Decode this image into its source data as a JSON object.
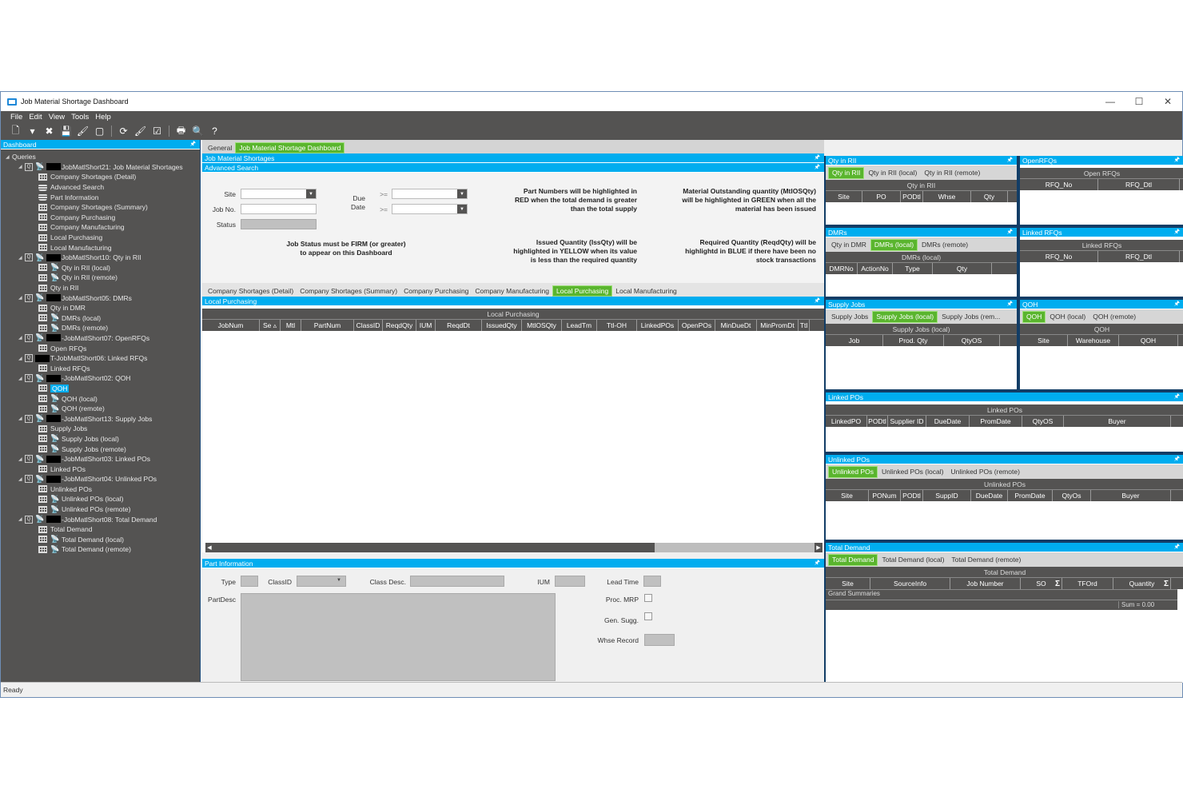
{
  "window": {
    "title": "Job Material Shortage Dashboard",
    "controls": {
      "minimize": "—",
      "maximize": "☐",
      "close": "✕"
    }
  },
  "menu": [
    "File",
    "Edit",
    "View",
    "Tools",
    "Help"
  ],
  "toolbar": [
    {
      "icon": "new-icon",
      "glyph": "🗋"
    },
    {
      "icon": "dropdown-icon",
      "glyph": "▾"
    },
    {
      "icon": "delete-icon",
      "glyph": "✖"
    },
    {
      "icon": "save-icon",
      "glyph": "💾"
    },
    {
      "icon": "clear-icon",
      "glyph": "🖌"
    },
    {
      "icon": "note-icon",
      "glyph": "▢"
    },
    {
      "icon": "refresh-icon",
      "glyph": "⟳"
    },
    {
      "icon": "clear-all-icon",
      "glyph": "🖌"
    },
    {
      "icon": "check-icon",
      "glyph": "☑"
    },
    {
      "icon": "print-icon",
      "glyph": "🖶"
    },
    {
      "icon": "preview-icon",
      "glyph": "🔍"
    },
    {
      "icon": "help-icon",
      "glyph": "?"
    }
  ],
  "sidebar": {
    "title": "Dashboard",
    "pin": "🖈",
    "root": "Queries",
    "items": [
      {
        "type": "query",
        "label": "JobMatlShort21: Job Material Shortages"
      },
      {
        "type": "grid",
        "label": "Company Shortages (Detail)"
      },
      {
        "type": "form",
        "label": "Advanced Search"
      },
      {
        "type": "form",
        "label": "Part Information"
      },
      {
        "type": "grid",
        "label": "Company Shortages (Summary)"
      },
      {
        "type": "grid",
        "label": "Company Purchasing"
      },
      {
        "type": "grid",
        "label": "Company Manufacturing"
      },
      {
        "type": "grid",
        "label": "Local Purchasing"
      },
      {
        "type": "grid",
        "label": "Local Manufacturing"
      },
      {
        "type": "query",
        "label": "JobMatlShort10: Qty in RII"
      },
      {
        "type": "remote",
        "label": "Qty in RII (local)"
      },
      {
        "type": "remote",
        "label": "Qty in RII (remote)"
      },
      {
        "type": "grid",
        "label": "Qty in RII"
      },
      {
        "type": "query",
        "label": "JobMatlShort05: DMRs"
      },
      {
        "type": "grid",
        "label": "Qty in DMR"
      },
      {
        "type": "remote",
        "label": "DMRs (local)"
      },
      {
        "type": "remote",
        "label": "DMRs (remote)"
      },
      {
        "type": "query",
        "label": "-JobMatlShort07: OpenRFQs"
      },
      {
        "type": "grid",
        "label": "Open RFQs"
      },
      {
        "type": "query2",
        "label": "T-JobMatlShort06: Linked RFQs"
      },
      {
        "type": "grid",
        "label": "Linked RFQs"
      },
      {
        "type": "query",
        "label": "-JobMatlShort02: QOH"
      },
      {
        "type": "grid",
        "label": "QOH",
        "selected": true
      },
      {
        "type": "remote",
        "label": "QOH (local)"
      },
      {
        "type": "remote",
        "label": "QOH (remote)"
      },
      {
        "type": "query",
        "label": "-JobMatlShort13: Supply Jobs"
      },
      {
        "type": "grid",
        "label": "Supply Jobs"
      },
      {
        "type": "remote",
        "label": "Supply Jobs (local)"
      },
      {
        "type": "remote",
        "label": "Supply Jobs (remote)"
      },
      {
        "type": "query",
        "label": "-JobMatlShort03: Linked POs"
      },
      {
        "type": "grid",
        "label": "Linked POs"
      },
      {
        "type": "query",
        "label": "-JobMatlShort04: Unlinked POs"
      },
      {
        "type": "grid",
        "label": "Unlinked POs"
      },
      {
        "type": "remote",
        "label": "Unlinked POs (local)"
      },
      {
        "type": "remote",
        "label": "Unlinked POs (remote)"
      },
      {
        "type": "query",
        "label": "-JobMatlShort08: Total Demand"
      },
      {
        "type": "grid",
        "label": "Total Demand"
      },
      {
        "type": "remote",
        "label": "Total Demand (local)"
      },
      {
        "type": "remote",
        "label": "Total Demand (remote)"
      }
    ]
  },
  "main": {
    "tabs": [
      "General",
      "Job Material Shortage Dashboard"
    ],
    "active_tab": 1,
    "section_title": "Job Material Shortages",
    "advanced": {
      "title": "Advanced Search",
      "site_label": "Site",
      "site_value": "",
      "jobno_label": "Job No.",
      "jobno_value": "",
      "status_label": "Status",
      "status_value": "",
      "due_label": "Due",
      "date_label": "Date",
      "op1": ">=",
      "op2": ">=",
      "note_firm": "Job Status must be FIRM (or greater)\nto appear on this Dashboard",
      "note_red": "Part Numbers will be highlighted in\nRED when the total demand is greater\nthan the total supply",
      "note_green": "Material Outstanding quantity (MtlOSQty)\nwill be highlighted in GREEN when all the\nmaterial has been issued",
      "note_yellow": "Issued Quantity (IssQty) will be\nhighlighted in YELLOW when its value\nis less than the required quantity",
      "note_blue": "Required Quantity (ReqdQty) will be\nhighlightd in BLUE if there have been no\nstock transactions"
    },
    "subtabs": [
      "Company Shortages (Detail)",
      "Company Shortages (Summary)",
      "Company Purchasing",
      "Company Manufacturing",
      "Local Purchasing",
      "Local Manufacturing"
    ],
    "active_subtab": 4,
    "grid": {
      "title": "Local Purchasing",
      "group": "Local Purchasing",
      "columns": [
        "JobNum",
        "Se ▵",
        "Mtl",
        "PartNum",
        "ClassID",
        "ReqdQty",
        "IUM",
        "ReqdDt",
        "IssuedQty",
        "MtlOSQty",
        "LeadTm",
        "Ttl-OH",
        "LinkedPOs",
        "OpenPOs",
        "MinDueDt",
        "MinPromDt",
        "Ttl"
      ]
    },
    "part": {
      "title": "Part Information",
      "type_label": "Type",
      "classid_label": "ClassID",
      "classdesc_label": "Class Desc.",
      "ium_label": "IUM",
      "leadtime_label": "Lead Time",
      "partdesc_label": "PartDesc",
      "procmrp_label": "Proc. MRP",
      "gensugg_label": "Gen. Sugg.",
      "whse_label": "Whse Record",
      "procmrp_checked": false,
      "gensugg_checked": false
    }
  },
  "panels": {
    "qty_rii": {
      "title": "Qty in RII",
      "tabs": [
        "Qty in RII",
        "Qty in RII (local)",
        "Qty in RII (remote)"
      ],
      "group": "Qty in RII",
      "columns": [
        "Site",
        "PO",
        "PODtl",
        "Whse",
        "Qty"
      ]
    },
    "open_rfqs": {
      "title": "OpenRFQs",
      "group": "Open RFQs",
      "columns": [
        "RFQ_No",
        "RFQ_Dtl"
      ]
    },
    "dmrs": {
      "title": "DMRs",
      "tabs": [
        "Qty in DMR",
        "DMRs (local)",
        "DMRs (remote)"
      ],
      "group": "DMRs (local)",
      "columns": [
        "DMRNo",
        "ActionNo",
        "Type",
        "Qty"
      ]
    },
    "linked_rfqs": {
      "title": "Linked RFQs",
      "group": "Linked RFQs",
      "columns": [
        "RFQ_No",
        "RFQ_Dtl"
      ]
    },
    "supply_jobs": {
      "title": "Supply Jobs",
      "tabs": [
        "Supply Jobs",
        "Supply Jobs (local)",
        "Supply Jobs (rem..."
      ],
      "group": "Supply Jobs (local)",
      "columns": [
        "Job",
        "Prod. Qty",
        "QtyOS"
      ]
    },
    "qoh": {
      "title": "QOH",
      "tabs": [
        "QOH",
        "QOH (local)",
        "QOH (remote)"
      ],
      "group": "QOH",
      "columns": [
        "Site",
        "Warehouse",
        "QOH"
      ]
    },
    "linked_pos": {
      "title": "Linked POs",
      "group": "Linked POs",
      "columns": [
        "LinkedPO",
        "PODtl",
        "Supplier ID",
        "DueDate",
        "PromDate",
        "QtyOS",
        "Buyer"
      ]
    },
    "unlinked_pos": {
      "title": "Unlinked POs",
      "tabs": [
        "Unlinked POs",
        "Unlinked POs (local)",
        "Unlinked POs (remote)"
      ],
      "group": "Unlinked POs",
      "columns": [
        "Site",
        "PONum",
        "PODtl",
        "SuppID",
        "DueDate",
        "PromDate",
        "QtyOs",
        "Buyer"
      ]
    },
    "total_demand": {
      "title": "Total Demand",
      "tabs": [
        "Total Demand",
        "Total Demand (local)",
        "Total Demand (remote)"
      ],
      "group": "Total Demand",
      "columns": [
        "Site",
        "SourceInfo",
        "Job Number",
        "SO",
        "TFOrd",
        "Quantity"
      ],
      "grand_summaries": "Grand Summaries",
      "sum": "Sum = 0.00"
    }
  },
  "status": "Ready",
  "colors": {
    "accent_blue": "#00adef",
    "active_green": "#5ab52e",
    "dark_gray": "#545352"
  }
}
